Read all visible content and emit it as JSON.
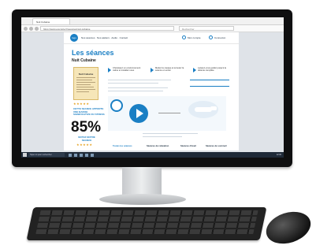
{
  "browser": {
    "tab_title": "Nuit Cubaine",
    "url": "https://www.exemple.fr/seances/nuit-cubaine",
    "search_placeholder": "Rechercher"
  },
  "site": {
    "logo": "logo",
    "nav_text": "Nos séances · Nos ateliers · Audio · Contact",
    "header_links": [
      "Mon compte",
      "Connexion"
    ]
  },
  "page": {
    "title": "Les séances",
    "subtitle": "Nuit Cubaine"
  },
  "book": {
    "title": "Nuit Cubaine"
  },
  "steps": [
    {
      "text": "Choisissez un environnement calme et installez-vous"
    },
    {
      "text": "Mettez le casque et écoutez la séance en entier"
    },
    {
      "text": "Laissez-vous guider jusqu'à la détente complète"
    }
  ],
  "stats": {
    "label": "CETTE SEANCE APPORTE UNE BAISSE SIGNIFICATIVE DU STRESS",
    "value": "85%",
    "rate_label": "NOTEZ NOTRE SEANCE",
    "stars": "★★★★★"
  },
  "footer": {
    "links": [
      "Toutes les séances",
      "Séances de relaxation",
      "Séances d'éveil",
      "Séances de sommeil"
    ]
  },
  "taskbar": {
    "search_text": "Taper ici pour rechercher",
    "clock": "12:00"
  },
  "colors": {
    "accent": "#1a7fc4",
    "star": "#e5a01c"
  }
}
